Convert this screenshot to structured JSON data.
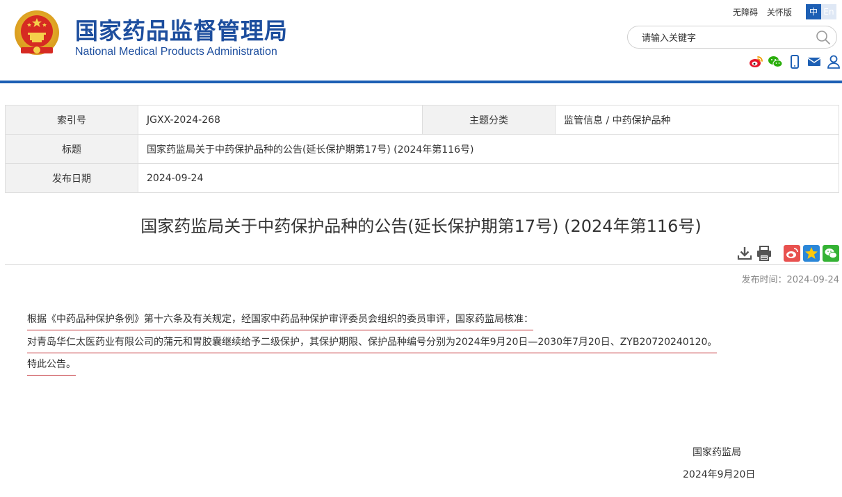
{
  "header": {
    "site_name_cn": "国家药品监督管理局",
    "site_name_en": "National Medical Products Administration",
    "toplinks": [
      "无障碍",
      "关怀版"
    ],
    "lang": {
      "cn": "中",
      "en": "En"
    },
    "search": {
      "placeholder": "请输入关键字"
    },
    "share_icons": [
      "weibo-icon",
      "wechat-icon",
      "mobile-icon",
      "mail-icon",
      "user-icon"
    ]
  },
  "info_table": {
    "index_label": "索引号",
    "index_value": "JGXX-2024-268",
    "category_label": "主题分类",
    "category_value": "监管信息 / 中药保护品种",
    "title_label": "标题",
    "title_value": "国家药监局关于中药保护品种的公告(延长保护期第17号) (2024年第116号)",
    "date_label": "发布日期",
    "date_value": "2024-09-24"
  },
  "article": {
    "title": "国家药监局关于中药保护品种的公告(延长保护期第17号) (2024年第116号)",
    "publish_time": "发布时间：2024-09-24",
    "tools": [
      "download-icon",
      "print-icon",
      "share-weibo-icon",
      "share-qzone-icon",
      "share-wechat-icon"
    ],
    "paragraphs": [
      "根据《中药品种保护条例》第十六条及有关规定，经国家中药品种保护审评委员会组织的委员审评，国家药监局核准：",
      "对青岛华仁太医药业有限公司的蒲元和胃胶囊继续给予二级保护，其保护期限、保护品种编号分别为2024年9月20日—2030年7月20日、ZYB20720240120。",
      "特此公告。"
    ],
    "signature": "国家药监局",
    "sign_date": "2024年9月20日"
  },
  "colors": {
    "brand_blue": "#1d5fb4",
    "underline_red": "#c0272d"
  }
}
